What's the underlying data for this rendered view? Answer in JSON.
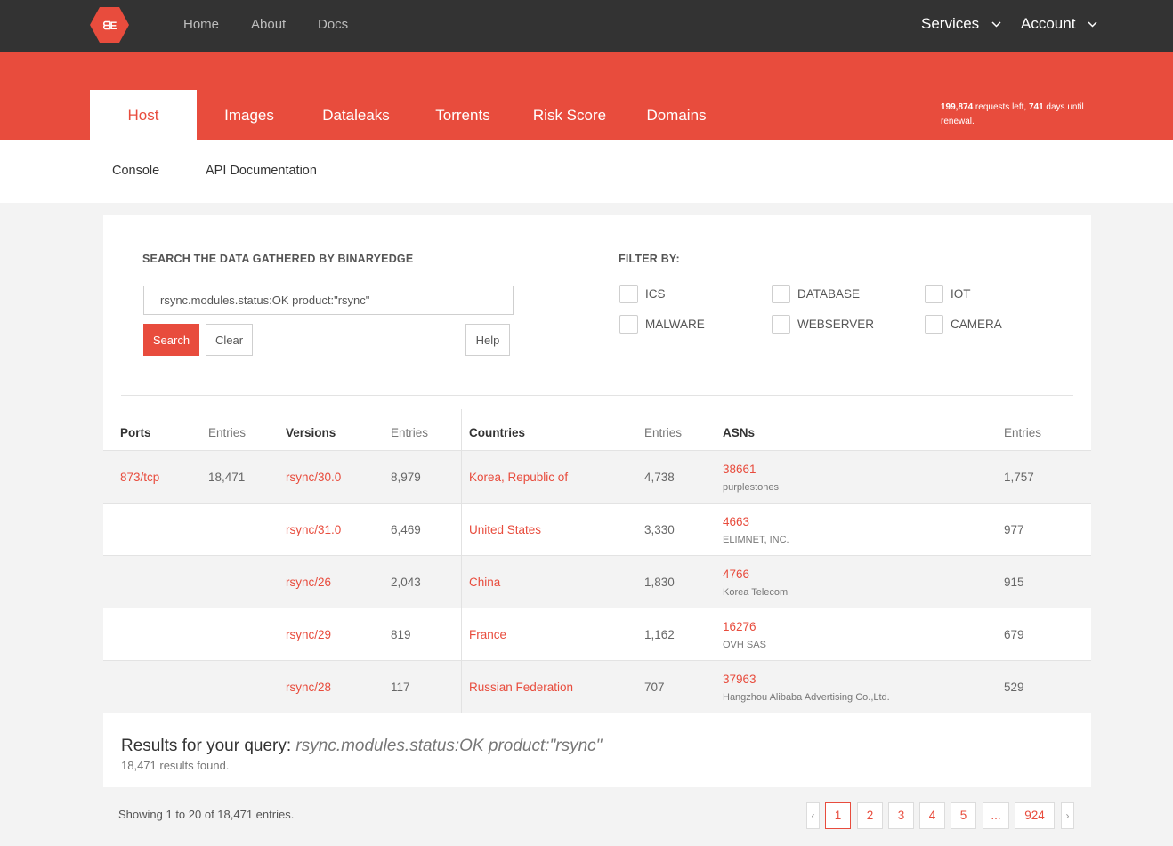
{
  "nav": {
    "logo_text": "BE",
    "links": [
      "Home",
      "About",
      "Docs"
    ],
    "services_label": "Services",
    "account_label": "Account"
  },
  "tabs": [
    "Host",
    "Images",
    "Dataleaks",
    "Torrents",
    "Risk Score",
    "Domains"
  ],
  "quota": {
    "requests_left": "199,874",
    "requests_text": " requests left, ",
    "days": "741",
    "days_text": " days until renewal."
  },
  "subnav": {
    "console": "Console",
    "api_docs": "API Documentation"
  },
  "search": {
    "heading": "SEARCH THE DATA GATHERED BY BINARYEDGE",
    "query": "rsync.modules.status:OK product:\"rsync\"",
    "search_label": "Search",
    "clear_label": "Clear",
    "help_label": "Help"
  },
  "filters": {
    "heading": "FILTER BY:",
    "items": [
      "ICS",
      "DATABASE",
      "IOT",
      "MALWARE",
      "WEBSERVER",
      "CAMERA"
    ]
  },
  "table": {
    "headers": {
      "ports": "Ports",
      "versions": "Versions",
      "countries": "Countries",
      "asns": "ASNs",
      "entries": "Entries"
    },
    "ports": [
      {
        "port": "873/tcp",
        "entries": "18,471"
      }
    ],
    "rows": [
      {
        "version": "rsync/30.0",
        "v_entries": "8,979",
        "country": "Korea, Republic of",
        "c_entries": "4,738",
        "asn": "38661",
        "asn_name": "purplestones",
        "a_entries": "1,757"
      },
      {
        "version": "rsync/31.0",
        "v_entries": "6,469",
        "country": "United States",
        "c_entries": "3,330",
        "asn": "4663",
        "asn_name": "ELIMNET, INC.",
        "a_entries": "977"
      },
      {
        "version": "rsync/26",
        "v_entries": "2,043",
        "country": "China",
        "c_entries": "1,830",
        "asn": "4766",
        "asn_name": "Korea Telecom",
        "a_entries": "915"
      },
      {
        "version": "rsync/29",
        "v_entries": "819",
        "country": "France",
        "c_entries": "1,162",
        "asn": "16276",
        "asn_name": "OVH SAS",
        "a_entries": "679"
      },
      {
        "version": "rsync/28",
        "v_entries": "117",
        "country": "Russian Federation",
        "c_entries": "707",
        "asn": "37963",
        "asn_name": "Hangzhou Alibaba Advertising Co.,Ltd.",
        "a_entries": "529"
      }
    ]
  },
  "results": {
    "prefix": "Results for your query: ",
    "query": "rsync.modules.status:OK product:\"rsync\"",
    "count": "18,471 results found."
  },
  "pagination": {
    "showing": "Showing 1 to 20 of 18,471 entries.",
    "prev": "‹",
    "next": "›",
    "pages": [
      "1",
      "2",
      "3",
      "4",
      "5",
      "...",
      "924"
    ]
  },
  "colors": {
    "accent": "#e84c3d",
    "topbar": "#333333"
  }
}
